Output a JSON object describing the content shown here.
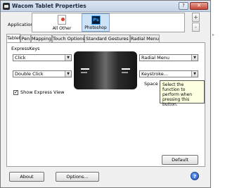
{
  "window": {
    "title": "Wacom Tablet Properties",
    "help_symbol": "?",
    "close_symbol": "✕"
  },
  "application": {
    "label": "Application:",
    "items": [
      {
        "label": "All Other"
      },
      {
        "label": "Photoshop",
        "icon_text": "Ps"
      }
    ],
    "add_symbol": "+",
    "remove_symbol": "-",
    "scroll_left": "◂",
    "scroll_right": "▸"
  },
  "tabs": [
    "Tablet",
    "Pen",
    "Mapping",
    "Touch Options",
    "Standard Gestures",
    "Radial Menu"
  ],
  "active_tab": "Tablet",
  "express_keys": {
    "section_label": "ExpressKeys",
    "left_top": "Click",
    "left_bottom": "Double Click",
    "right_top": "Radial Menu",
    "right_bottom": "Keystroke...",
    "space_label": "Space",
    "tooltip": "Select the function to perform when pressing this button.",
    "show_express_view": {
      "label": "Show Express View",
      "checked": true
    }
  },
  "buttons": {
    "default": "Default",
    "about": "About",
    "options": "Options...",
    "help": "?"
  },
  "dropdown_arrow": "▼"
}
